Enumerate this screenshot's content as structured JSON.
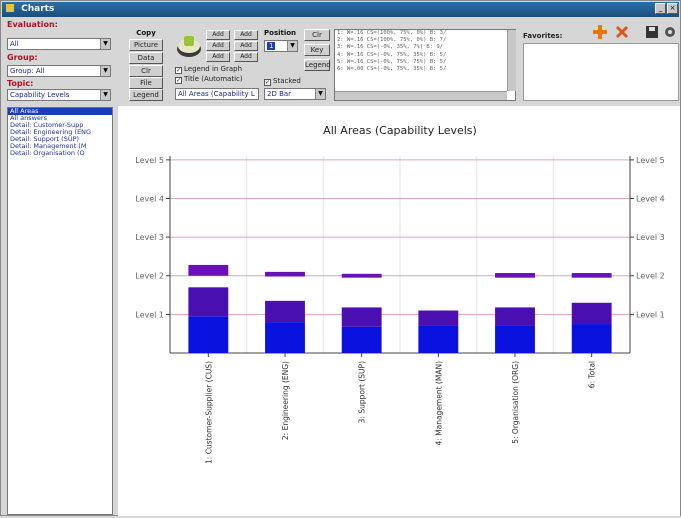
{
  "window": {
    "title": "Charts"
  },
  "left_panel": {
    "evaluation_label": "Evaluation:",
    "evaluation_value": "All",
    "group_label": "Group:",
    "group_value": "Group: All",
    "topic_label": "Topic:",
    "topic_value": "Capability Levels",
    "areas_list": [
      "All Areas",
      "All answers",
      "Detail: Customer-Supp",
      "Detail: Engineering (ENG",
      "Detail: Support (SUP)",
      "Detail: Management (M",
      "Detail: Organisation (O"
    ],
    "selected_index": 0
  },
  "toolbar": {
    "copy_label": "Copy",
    "picture_button": "Picture",
    "data_button": "Data",
    "clr_button": "Clr",
    "file_button": "File",
    "legend_button": "Legend",
    "add_buttons": [
      "Add",
      "Add",
      "Add"
    ],
    "nav_buttons": [
      "Add",
      "Add",
      "Add"
    ],
    "position_label": "Position",
    "position_value": "1",
    "clr2_button": "Clr",
    "key_button": "Key",
    "legend2_button": "Legend",
    "legend_in_graph_label": "Legend in Graph",
    "legend_in_graph_checked": true,
    "title_auto_label": "Title (Automatic)",
    "title_auto_checked": true,
    "stacked_label": "Stacked",
    "stacked_checked": true,
    "title_combo_value": "All Areas (Capability L",
    "chart_type_value": "2D Bar",
    "favorites_label": "Favorites:"
  },
  "code_lines": [
    "1:  W=.16  CS=(100%, 75%, 0%)  B:  3/",
    "2:  W=.16  CS=(100%, 75%, 0%)  B:  7/",
    "3:  W=.16  CS=(-0%, 35%,  7%)  B:  9/",
    "4:  W=.16  CS=(-0%, 75%, 35%)  B:  5/",
    "5:  W=.16  CS=(-0%, 75%, 75%)  B:  5/",
    "6:  W=.00  CS=(-0%, 75%, 35%)  B:  5/"
  ],
  "chart_data": {
    "type": "bar",
    "stacked": true,
    "title": "All Areas (Capability Levels)",
    "categories": [
      "1: Customer-Supplier (CUS)",
      "2: Engineering (ENG)",
      "3: Support (SUP)",
      "4: Management (MAN)",
      "5: Organisation (ORG)",
      "6: Total"
    ],
    "y_tick_labels": [
      "Level 1",
      "Level 2",
      "Level 3",
      "Level 4",
      "Level 5"
    ],
    "y_ticks": [
      1,
      2,
      3,
      4,
      5
    ],
    "ylim": [
      0,
      5.1
    ],
    "right_axis_mirror": true,
    "series": [
      {
        "color": "#0a12e0",
        "values": [
          0.95,
          0.8,
          0.68,
          0.7,
          0.7,
          0.75
        ]
      },
      {
        "color": "#4a0fb0",
        "values": [
          0.75,
          0.55,
          0.5,
          0.4,
          0.48,
          0.55
        ]
      },
      {
        "color": "#ffffff",
        "values": [
          0.3,
          0.63,
          0.77,
          0.9,
          0.77,
          0.65
        ]
      },
      {
        "color": "#6a10b8",
        "values": [
          0.28,
          0.12,
          0.1,
          0.0,
          0.12,
          0.12
        ]
      }
    ],
    "grid": true,
    "gridline_color": "#e0a0c0"
  }
}
